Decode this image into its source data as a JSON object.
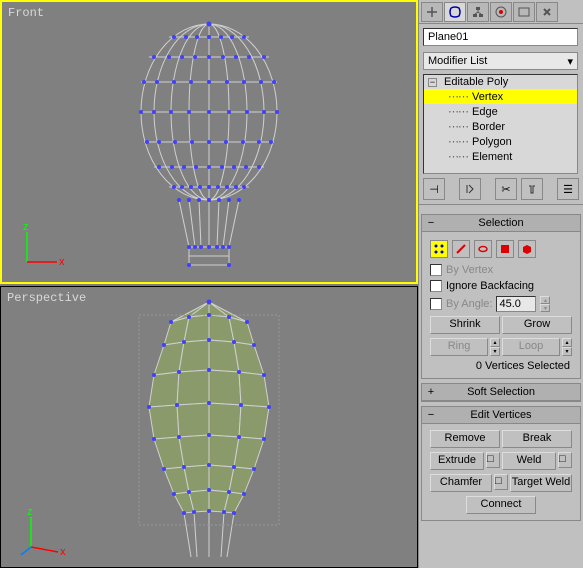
{
  "viewports": {
    "front_label": "Front",
    "perspective_label": "Perspective"
  },
  "panel": {
    "object_name": "Plane01",
    "modifier_list_label": "Modifier List",
    "tree": {
      "root": "Editable Poly",
      "items": [
        "Vertex",
        "Edge",
        "Border",
        "Polygon",
        "Element"
      ]
    }
  },
  "selection": {
    "header": "Selection",
    "by_vertex": "By Vertex",
    "ignore_backfacing": "Ignore Backfacing",
    "by_angle": "By Angle:",
    "angle_value": "45.0",
    "shrink": "Shrink",
    "grow": "Grow",
    "ring": "Ring",
    "loop": "Loop",
    "status": "0 Vertices Selected"
  },
  "soft_selection": {
    "header": "Soft Selection"
  },
  "edit_vertices": {
    "header": "Edit Vertices",
    "remove": "Remove",
    "break": "Break",
    "extrude": "Extrude",
    "weld": "Weld",
    "chamfer": "Chamfer",
    "target_weld": "Target Weld",
    "connect": "Connect"
  }
}
